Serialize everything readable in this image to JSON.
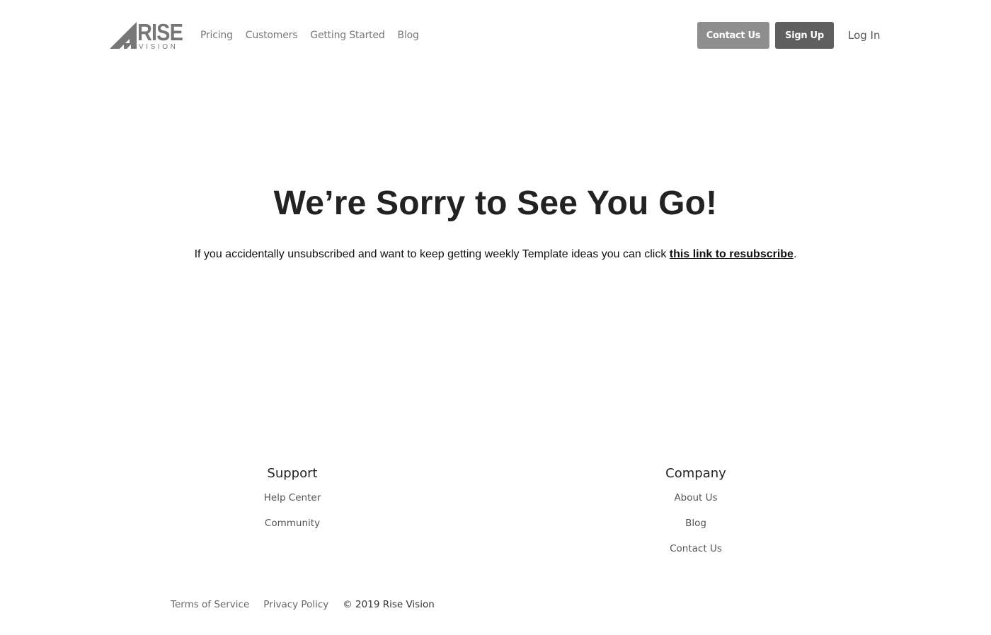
{
  "header": {
    "logo_text": "RISE",
    "logo_subtext": "VISION",
    "nav": [
      {
        "label": "Pricing"
      },
      {
        "label": "Customers"
      },
      {
        "label": "Getting Started"
      },
      {
        "label": "Blog"
      }
    ],
    "contact_label": "Contact Us",
    "signup_label": "Sign Up",
    "login_label": "Log In"
  },
  "main": {
    "headline": "We’re Sorry to See You Go!",
    "subtext_before": "If you accidentally unsubscribed and want to keep getting weekly Template ideas you can click ",
    "subtext_link": "this link to resubscribe",
    "subtext_after": "."
  },
  "footer": {
    "support": {
      "title": "Support",
      "links": [
        {
          "label": "Help Center"
        },
        {
          "label": "Community"
        }
      ]
    },
    "company": {
      "title": "Company",
      "links": [
        {
          "label": "About Us"
        },
        {
          "label": "Blog"
        },
        {
          "label": "Contact Us"
        }
      ]
    },
    "legal": {
      "terms": "Terms of Service",
      "privacy": "Privacy Policy",
      "copyright": "© 2019 Rise Vision"
    }
  },
  "colors": {
    "contact_button": "#8e8e8e",
    "signup_button": "#5f5f5f",
    "logo": "#777777"
  }
}
